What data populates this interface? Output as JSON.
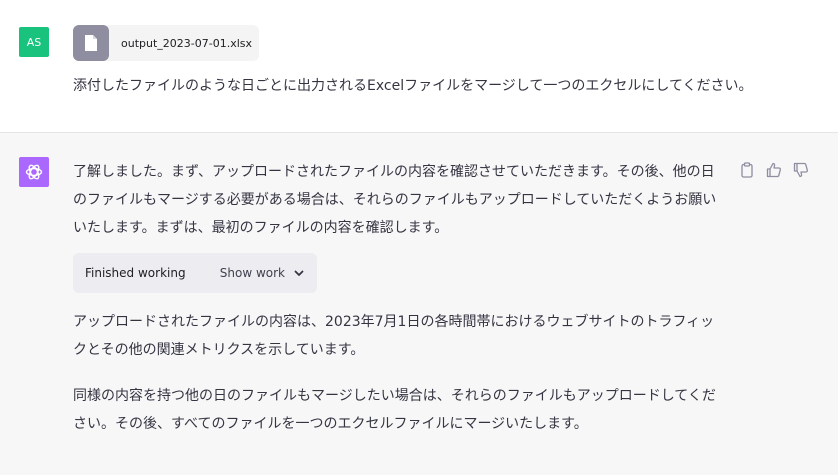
{
  "user": {
    "avatar_initials": "AS",
    "attachment": {
      "filename": "output_2023-07-01.xlsx",
      "icon": "file-icon"
    },
    "message": "添付したファイルのような日ごとに出力されるExcelファイルをマージして一つのエクセルにしてください。"
  },
  "assistant": {
    "avatar_icon": "openai-logo-icon",
    "paragraph_1": "了解しました。まず、アップロードされたファイルの内容を確認させていただきます。その後、他の日のファイルもマージする必要がある場合は、それらのファイルもアップロードしていただくようお願いいたします。まずは、最初のファイルの内容を確認します。",
    "work_status": {
      "label": "Finished working",
      "toggle_label": "Show work"
    },
    "paragraph_2": "アップロードされたファイルの内容は、2023年7月1日の各時間帯におけるウェブサイトのトラフィックとその他の関連メトリクスを示しています。",
    "paragraph_3": "同様の内容を持つ他の日のファイルもマージしたい場合は、それらのファイルもアップロードしてください。その後、すべてのファイルを一つのエクセルファイルにマージいたします。",
    "actions": [
      "clipboard-icon",
      "thumbs-up-icon",
      "thumbs-down-icon"
    ]
  },
  "colors": {
    "user_avatar": "#19c37d",
    "assistant_avatar": "#ab68ff",
    "assistant_bg": "#f7f7f8",
    "file_icon_bg": "#8e8ea0"
  }
}
